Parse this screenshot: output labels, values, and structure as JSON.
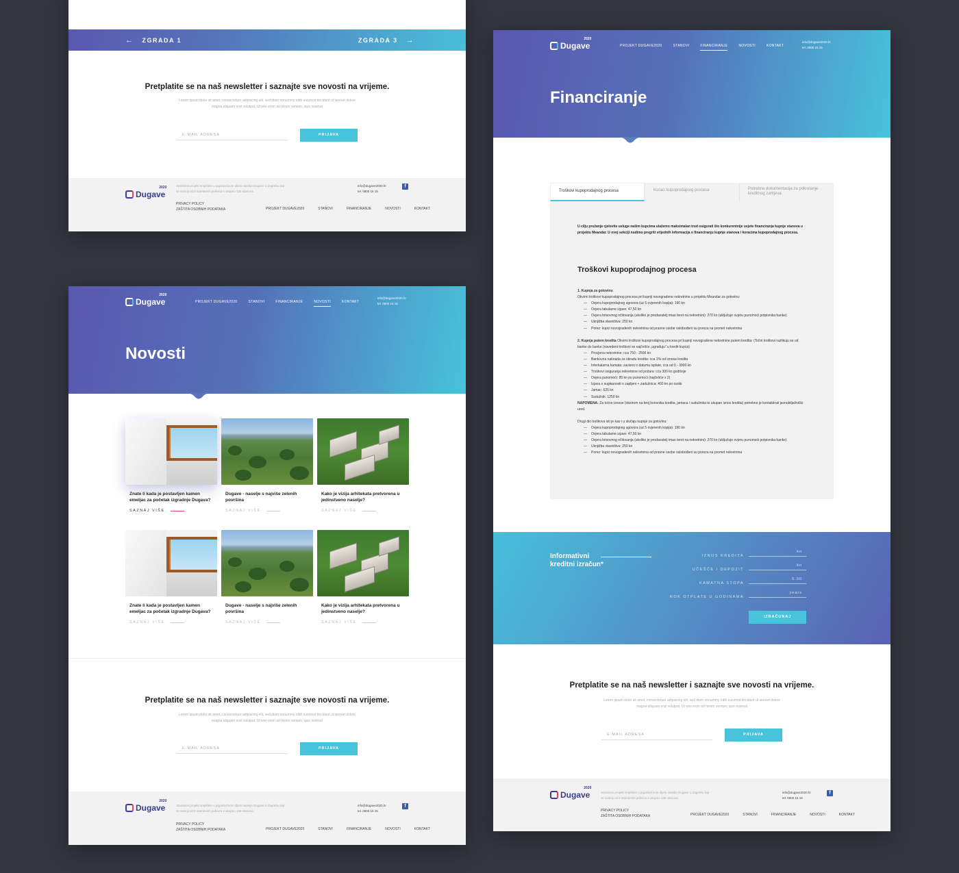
{
  "brand": {
    "name": "Dugave",
    "year": "2020"
  },
  "nav": {
    "items": [
      "PROJEKT DUGAVE2020",
      "STANOVI",
      "FINANCIRANJE",
      "NOVOSTI",
      "KONTAKT"
    ],
    "email": "info@dugave2020.hr",
    "phone": "tel. 0800 15 15"
  },
  "building_nav": {
    "prev": "ZGRADA 1",
    "next": "ZGRADA 3"
  },
  "newsletter": {
    "title": "Pretplatite se na naš newsletter i saznajte sve novosti na vrijeme.",
    "text": "Lorem ipsum dolor sit amet, consectetuer adipiscing elit, sed diam nonummy nibh euismod tincidunt ut laoreet dolore magna aliquam erat volutpat. Ut wisi enim ad minim veniam, quis nostrud",
    "placeholder": "E-MAIL ADRESA",
    "button": "PRIJAVA"
  },
  "footer": {
    "desc": "Stambeni projekt smješten u jugoistočnom dijelu naselja Dugave u Zagrebu koji se sastoji od 8 stambenih jedinica s ukupno 136 stanova.",
    "privacy": "PRIVACY POLICY",
    "data_protection": "ZAŠTITA OSOBNIH PODATAKA",
    "email": "info@dugave2020.hr",
    "phone": "tel. 0800 15 15",
    "fb": "f"
  },
  "novosti": {
    "title": "Novosti",
    "more": "SAZNAJ VIŠE",
    "cards": [
      {
        "title": "Znate li kada je postavljen kamen emeljac za početak izgradnje Dugava?"
      },
      {
        "title": "Dugave - naselje s najviše zelenih površina"
      },
      {
        "title": "Kako je vizija arhitekata pretvorena u jedinstveno naselje?"
      },
      {
        "title": "Znate li kada je postavljen kamen emeljac za početak izgradnje Dugava?"
      },
      {
        "title": "Dugave - naselje s najviše zelenih površina"
      },
      {
        "title": "Kako je vizija arhitekata pretvorena u jedinstveno naselje?"
      }
    ]
  },
  "financiranje": {
    "title": "Financiranje",
    "tabs": [
      "Troškovi kupoprodajnog procesa",
      "Koraci kupoprodajnog procesa",
      "Potrebna dokumentacija za pokretanje kreditnog zahtjeva"
    ],
    "intro": "U cilju pružanja cjelovite usluge našim kupcima ulažemo maksimalan trud osigurati što konkurentnije uvjete financiranja kupnje stanova u projektu Meandar. U ovoj sekciji nudimo pregršt vrijednih informacija o financiranju kupnje stanova i koracima kupoprodajnog procesa.",
    "heading": "Troškovi kupoprodajnog procesa",
    "s1_title": "1. Kupnja za gotovinu",
    "s1_text": "Okvirni troškovi kupoprodajnog procesa pri kupnji novogradene nekretnine u projektu Meandar za gotovinu:",
    "s1_items": [
      "Ovjera kupoprodajnog ugovora (uz 5 ovjerenih kopija): 190 kn",
      "Ovjera tabularne izjave: 47,50 kn",
      "Ovjera brisovnog očitovanja (ukoliko je prodavatelj imao teret na nekretnini): 270 kn (uključuje ovjeru punomoći potpisnika banke)",
      "Uknjižba vlasništva: 250 kn",
      "Porez: kupci novogradenih nekretnina od pravne osobe oslobođeni su poreza na promet nekretnina"
    ],
    "s2_title": "2. Kupnja putem kredita",
    "s2_text": "Okvirni troškovi kupoprodajnog procesa pri kupnji novogradene nekretnine putem kredita: (Točni troškovi razlikuju se od banke do banke (navedeni troškovi se najčešće „ugrađuju\" u kredit kupca)",
    "s2_items": [
      "Procjena nekretnine: cca 750 - 2500 kn",
      "Bankovna naknada za obradu kredita: cca 1% od iznosa kredita",
      "Interkalarna kamata: zavisno o datumu isplate, cca od 0 - 3000 kn",
      "Troškovi osiguranja nekretnine od požara: cca 300 kn godišnje",
      "Ovjera punomoći: 85 kn po punomoći (najčešće x 2)",
      "Izjava o suglasnosti o zapljeni + zadužnica: 400 kn po osobi",
      "Jamac: 625 kn",
      "Sudužnik: 1250 kn"
    ],
    "note_label": "NAPOMENA:",
    "note_text": "Za točne iznose (obzirom na broj korisnika kredita, jamaca i sudužnika te ukupan iznos kredita) potrebno je kontaktirati javnobilježnički ured.",
    "s3_text": "Drugi dio troškova isti je kao i u slučaju kupnje za gotovinu:",
    "s3_items": [
      "Ovjera kupoprodajnog ugovora (uz 5 ovjerenih kopija): 190 kn",
      "Ovjera tabularne izjave: 47,50 kn",
      "Ovjera brisovnog očitovanja (ukoliko je prodavatelj imao teret na nekretnini): 270 kn (uključuje ovjeru punomoći potpisnika banke)",
      "Uknjižba vlasništva: 250 kn",
      "Porez: kupci novogradenih nekretnina od pravne osobe oslobođeni su poreza na promet nekretnina"
    ]
  },
  "calculator": {
    "title_line1": "Informativni",
    "title_line2": "kreditni izračun*",
    "fields": [
      {
        "label": "IZNOS KREDITA",
        "value": "kn"
      },
      {
        "label": "UČEŠĆE / DEPOZIT",
        "value": "kn"
      },
      {
        "label": "KAMATNA STOPA",
        "value": "5.00"
      },
      {
        "label": "ROK OTPLATE U GODINAMA",
        "value": "years"
      }
    ],
    "button": "IZRAČUNAJ"
  },
  "colors": {
    "accent": "#47c3db",
    "brand": "#3b3c8f",
    "red": "#e8405a",
    "bg": "#343640"
  }
}
